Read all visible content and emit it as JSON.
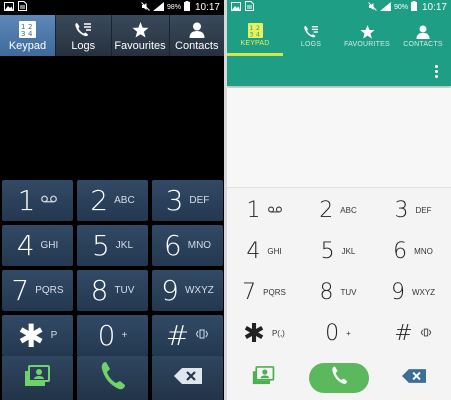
{
  "left": {
    "status": {
      "battery_pct": "98%",
      "time": "10:17"
    },
    "tabs": [
      {
        "label": "Keypad",
        "icon": "keypad-icon"
      },
      {
        "label": "Logs",
        "icon": "logs-icon"
      },
      {
        "label": "Favourites",
        "icon": "star-icon"
      },
      {
        "label": "Contacts",
        "icon": "person-icon"
      }
    ],
    "keys": [
      {
        "digit": "1",
        "sub": "QO"
      },
      {
        "digit": "2",
        "sub": "ABC"
      },
      {
        "digit": "3",
        "sub": "DEF"
      },
      {
        "digit": "4",
        "sub": "GHI"
      },
      {
        "digit": "5",
        "sub": "JKL"
      },
      {
        "digit": "6",
        "sub": "MNO"
      },
      {
        "digit": "7",
        "sub": "PQRS"
      },
      {
        "digit": "8",
        "sub": "TUV"
      },
      {
        "digit": "9",
        "sub": "WXYZ"
      },
      {
        "digit": "✱",
        "sub": "P"
      },
      {
        "digit": "0",
        "sub": "+"
      },
      {
        "digit": "#",
        "sub": "⁞⁞⁞"
      }
    ]
  },
  "right": {
    "status": {
      "battery_pct": "90%",
      "time": "10:17"
    },
    "tabs": [
      {
        "label": "KEYPAD",
        "icon": "keypad-icon"
      },
      {
        "label": "LOGS",
        "icon": "logs-icon"
      },
      {
        "label": "FAVOURITES",
        "icon": "star-icon"
      },
      {
        "label": "CONTACTS",
        "icon": "person-icon"
      }
    ],
    "keys": [
      {
        "digit": "1",
        "sub": "QO"
      },
      {
        "digit": "2",
        "sub": "ABC"
      },
      {
        "digit": "3",
        "sub": "DEF"
      },
      {
        "digit": "4",
        "sub": "GHI"
      },
      {
        "digit": "5",
        "sub": "JKL"
      },
      {
        "digit": "6",
        "sub": "MNO"
      },
      {
        "digit": "7",
        "sub": "PQRS"
      },
      {
        "digit": "8",
        "sub": "TUV"
      },
      {
        "digit": "9",
        "sub": "WXYZ"
      },
      {
        "digit": "✱",
        "sub": "P(,)"
      },
      {
        "digit": "0",
        "sub": "+"
      },
      {
        "digit": "#",
        "sub": "⁞⁞⁞"
      }
    ]
  },
  "colors": {
    "teal": "#1f9e86",
    "active_tab": "#e7f25a",
    "call_green": "#5cb85c",
    "left_key": "#2c425c"
  }
}
